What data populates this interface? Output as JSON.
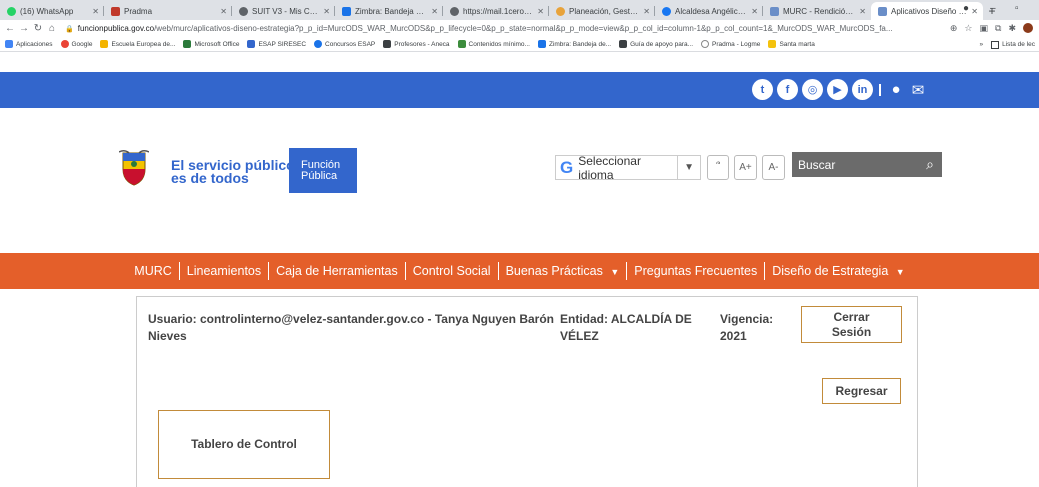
{
  "browser": {
    "tabs": [
      {
        "label": "(16) WhatsApp",
        "color": "#25d366"
      },
      {
        "label": "Pradma",
        "color": "#c0392b"
      },
      {
        "label": "SUIT V3 - Mis Cadena...",
        "color": "#5f6368"
      },
      {
        "label": "Zimbra: Bandeja de e...",
        "color": "#1a73e8"
      },
      {
        "label": "https://mail.1cero1.c...",
        "color": "#5f6368"
      },
      {
        "label": "Planeación, Gestión...",
        "color": "#e8a33b"
      },
      {
        "label": "Alcaldesa Angélica N...",
        "color": "#1877f2"
      },
      {
        "label": "MURC - Rendición de...",
        "color": "#6a8ec8"
      },
      {
        "label": "Aplicativos Diseño E...",
        "color": "#6a8ec8"
      }
    ],
    "new_tab": "+",
    "url_host": "funcionpublica.gov.co",
    "url_path": "/web/murc/aplicativos-diseno-estrategia?p_p_id=MurcODS_WAR_MurcODS&p_p_lifecycle=0&p_p_state=normal&p_p_mode=view&p_p_col_id=column-1&p_p_col_count=1&_MurcODS_WAR_MurcODS_fa...",
    "bookmarks": [
      {
        "label": "Aplicaciones",
        "color": "#4285f4"
      },
      {
        "label": "Google",
        "color": "#ea4335"
      },
      {
        "label": "Escuela Europea de...",
        "color": "#f4b400"
      },
      {
        "label": "Microsoft Office",
        "color": "#2b7a3b"
      },
      {
        "label": "ESAP SIRESEC",
        "color": "#3366cc"
      },
      {
        "label": "Concursos ESAP",
        "color": "#1a73e8"
      },
      {
        "label": "Profesores - Aneca",
        "color": "#3c4043"
      },
      {
        "label": "Contenidos mínimo...",
        "color": "#3c8c3c"
      },
      {
        "label": "Zimbra: Bandeja de...",
        "color": "#1a73e8"
      },
      {
        "label": "Guía de apoyo para...",
        "color": "#3c4043"
      },
      {
        "label": "Pradma - Logme",
        "color": "#888888"
      },
      {
        "label": "Santa marta",
        "color": "#f4c20d"
      }
    ],
    "bookmarks_more": "»",
    "reading_list": "Lista de lec"
  },
  "header": {
    "logo_line1": "El servicio público",
    "logo_line2": "es de todos",
    "logo_box_line1": "Función",
    "logo_box_line2": "Pública",
    "lang_label": "Seleccionar idioma",
    "rss_label": "՞",
    "font_up": "A+",
    "font_down": "A-",
    "search_placeholder": "Buscar"
  },
  "nav": [
    "MURC",
    "Lineamientos",
    "Caja de Herramientas",
    "Control Social",
    "Buenas Prácticas",
    "Preguntas Frecuentes",
    "Diseño de Estrategia"
  ],
  "session": {
    "user_line1": "Usuario: controlinterno@velez-santander.gov.co - Tanya Nguyen Barón",
    "user_line2": "Nieves",
    "entidad_line1": "Entidad: ALCALDÍA DE",
    "entidad_line2": "VÉLEZ",
    "vigencia_line1": "Vigencia:",
    "vigencia_line2": "2021",
    "logout_line1": "Cerrar",
    "logout_line2": "Sesión",
    "back": "Regresar",
    "dashboard": "Tablero de Control"
  },
  "colors": {
    "topbar": "#3366cc",
    "orange_nav": "#e45f2a",
    "button_border": "#c28b3a"
  }
}
